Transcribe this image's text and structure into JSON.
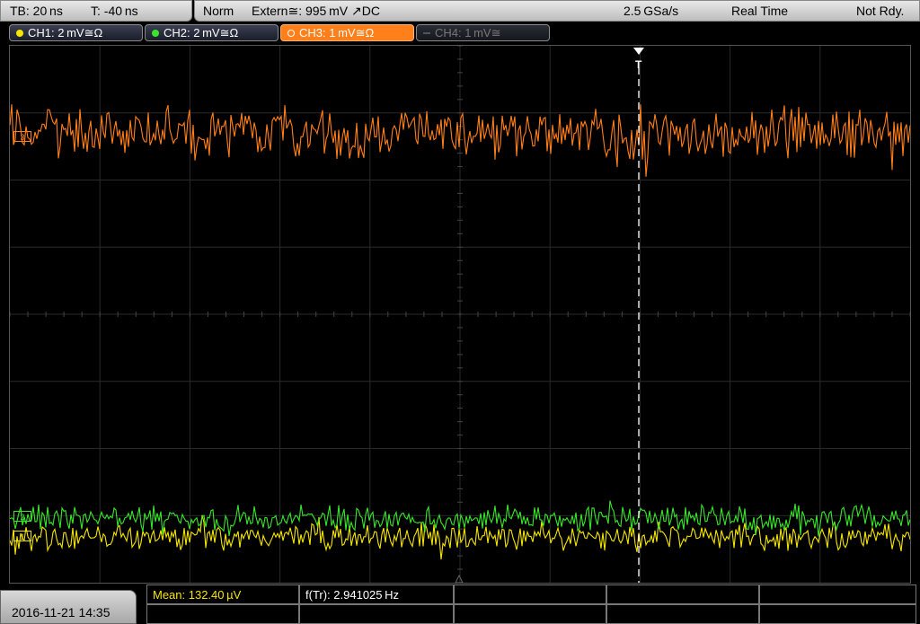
{
  "topbar": {
    "timebase": "TB: 20 ns",
    "trigger_time": "T: -40 ns",
    "mode": "Norm",
    "trigger_source": "Extern≅: 995 mV ↗DC",
    "sample_rate": "2.5 GSa/s",
    "acq_mode": "Real Time",
    "status": "Not Rdy."
  },
  "channels": [
    {
      "label": "CH1: 2 mV≅Ω",
      "color": "#f5e600",
      "state": "on"
    },
    {
      "label": "CH2: 2 mV≅Ω",
      "color": "#39e62c",
      "state": "on"
    },
    {
      "label": "CH3: 1 mV≅Ω",
      "color": "#ff7f1a",
      "state": "active"
    },
    {
      "label": "CH4: 1 mV≅",
      "color": "#666666",
      "state": "off"
    }
  ],
  "markers": {
    "trigger": "T",
    "ch1": "1",
    "ch2": "2",
    "ch3": "3"
  },
  "measurements": {
    "mean": "Mean: 132.40 µV",
    "freq": "f(Tr): 2.941025 Hz"
  },
  "footer": {
    "datetime": "2016-11-21 14:35"
  },
  "trace_colors": {
    "ch1": "#f5e600",
    "ch2": "#39e62c",
    "ch3": "#ff7f1a"
  }
}
